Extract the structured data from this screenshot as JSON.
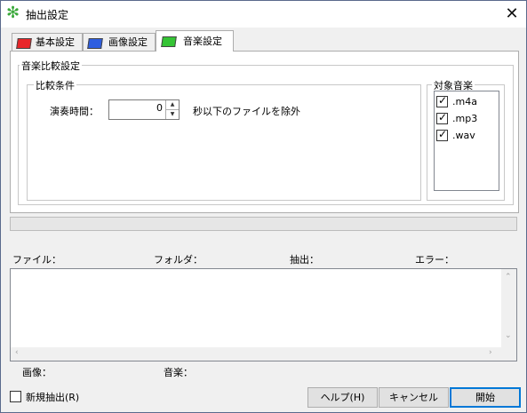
{
  "window": {
    "title": "抽出設定",
    "close": "✕",
    "app_icon": "green-asterisk-icon"
  },
  "tabs": [
    {
      "label": "基本設定",
      "color": "#e8262a"
    },
    {
      "label": "画像設定",
      "color": "#2e5ee0"
    },
    {
      "label": "音楽設定",
      "color": "#35c435",
      "active": true
    }
  ],
  "panel": {
    "group_title": "音楽比較設定",
    "conditions_title": "比較条件",
    "duration_label": "演奏時間：",
    "duration_value": "0",
    "duration_suffix": "秒以下のファイルを除外",
    "targets_title": "対象音楽",
    "targets": [
      {
        "label": ".m4a",
        "checked": true
      },
      {
        "label": ".mp3",
        "checked": true
      },
      {
        "label": ".wav",
        "checked": true
      }
    ]
  },
  "progress": {
    "value": 0
  },
  "columns": {
    "file": "ファイル：",
    "folder": "フォルダ：",
    "extract": "抽出：",
    "error": "エラー："
  },
  "status": {
    "images": "画像：",
    "music": "音楽："
  },
  "footer": {
    "new_extract": "新規抽出(R)",
    "new_extract_checked": false,
    "help": "ヘルプ(H)",
    "cancel": "キャンセル",
    "start": "開始"
  }
}
